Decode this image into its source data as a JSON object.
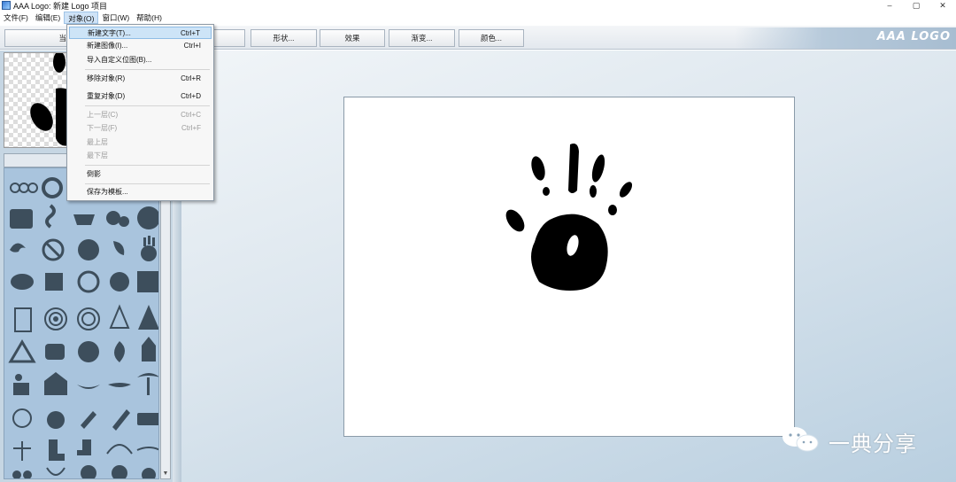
{
  "window": {
    "title": "AAA Logo: 新建 Logo 项目",
    "minimize": "–",
    "restore": "▢",
    "close": "✕"
  },
  "menubar": [
    {
      "label": "文件(F)"
    },
    {
      "label": "编辑(E)"
    },
    {
      "label": "对象(O)",
      "active": true
    },
    {
      "label": "窗口(W)"
    },
    {
      "label": "帮助(H)"
    }
  ],
  "toolbar": {
    "buttons": [
      "当前",
      "形状...",
      "效果",
      "渐变...",
      "颜色..."
    ],
    "brand": "AAA LOGO"
  },
  "object_menu": {
    "items": [
      {
        "label": "新建文字(T)...",
        "shortcut": "Ctrl+T",
        "highlight": true
      },
      {
        "label": "新建图像(I)...",
        "shortcut": "Ctrl+I"
      },
      {
        "label": "导入自定义位图(B)...",
        "shortcut": ""
      },
      {
        "label": "移除对象(R)",
        "shortcut": "Ctrl+R"
      },
      {
        "label": "重复对象(D)",
        "shortcut": "Ctrl+D"
      },
      {
        "label": "上一层(C)",
        "shortcut": "Ctrl+C",
        "disabled": true
      },
      {
        "label": "下一层(F)",
        "shortcut": "Ctrl+F",
        "disabled": true
      },
      {
        "label": "最上层",
        "shortcut": "",
        "disabled": true
      },
      {
        "label": "最下层",
        "shortcut": "",
        "disabled": true
      },
      {
        "label": "倒影",
        "shortcut": ""
      },
      {
        "label": "保存为模板...",
        "shortcut": ""
      }
    ]
  },
  "shape_library": {
    "icons": [
      "swirls-icon",
      "ring-icon",
      "",
      "",
      "",
      "coffee-box-icon",
      "squiggle-icon",
      "cup-icon",
      "gears-icon",
      "radiation-icon",
      "wave-icon",
      "lemon-icon",
      "no-sign-icon",
      "globe-icon",
      "planet-icon",
      "hand-icon",
      "turtle-icon",
      "gift-bottles-icon",
      "flower-icon",
      "ball-icon",
      "brick-wall-icon",
      "building-icon",
      "spiral-icon",
      "spiral-icon",
      "tree-outline-icon",
      "pine-tree-icon",
      "warning-icon",
      "handshake-icon",
      "fire-circle-icon",
      "flame-icon",
      "church-icon",
      "sun-house-icon",
      "house-icon",
      "wings-icon",
      "mustache-icon",
      "palm-tree-icon",
      "pig-icon",
      "bomb-face-icon",
      "paint-brush-icon",
      "brush-icon",
      "bus-icon",
      "stick-figure-icon",
      "boot-icon",
      "sock-icon",
      "arc-icon",
      "ribbon-icon",
      "glasses-icon",
      "necklace-icon",
      "tree-icon",
      "tree-icon",
      "bomb-icon"
    ]
  },
  "watermark": {
    "text": "一典分享",
    "icon": "wechat-icon"
  }
}
